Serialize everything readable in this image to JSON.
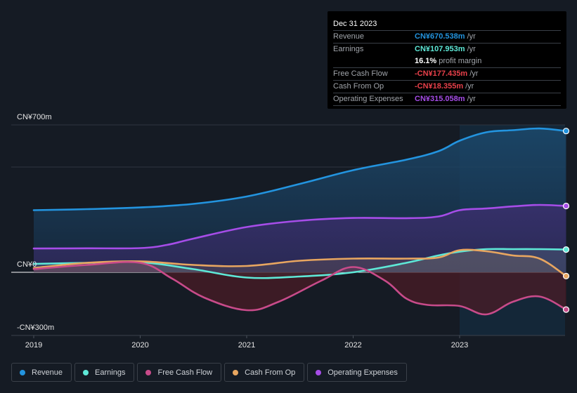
{
  "tooltip": {
    "date": "Dec 31 2023",
    "rows": [
      {
        "label": "Revenue",
        "value": "CN¥670.538m",
        "unit": "/yr",
        "color": "#2394df"
      },
      {
        "label": "Earnings",
        "value": "CN¥107.953m",
        "unit": "/yr",
        "color": "#5ee8d7"
      },
      {
        "label": "",
        "value": "16.1%",
        "unit": "profit margin",
        "color": "#ffffff"
      },
      {
        "label": "Free Cash Flow",
        "value": "-CN¥177.435m",
        "unit": "/yr",
        "color": "#e8404a"
      },
      {
        "label": "Cash From Op",
        "value": "-CN¥18.355m",
        "unit": "/yr",
        "color": "#e8404a"
      },
      {
        "label": "Operating Expenses",
        "value": "CN¥315.058m",
        "unit": "/yr",
        "color": "#a64de8"
      }
    ]
  },
  "legend": [
    {
      "label": "Revenue",
      "color": "#2394df"
    },
    {
      "label": "Earnings",
      "color": "#5ee8d7"
    },
    {
      "label": "Free Cash Flow",
      "color": "#c84b8a"
    },
    {
      "label": "Cash From Op",
      "color": "#e8a660"
    },
    {
      "label": "Operating Expenses",
      "color": "#a64de8"
    }
  ],
  "chart_data": {
    "type": "area",
    "title": "",
    "xlabel": "",
    "ylabel": "",
    "unit": "CN¥ millions",
    "ylim": [
      -300,
      700
    ],
    "xlim": [
      2018.8,
      2024.0
    ],
    "y_tick_labels": [
      {
        "value": 700,
        "label": "CN¥700m"
      },
      {
        "value": 0,
        "label": "CN¥0"
      },
      {
        "value": -300,
        "label": "-CN¥300m"
      }
    ],
    "gridlines": [
      700,
      500,
      0
    ],
    "x_tick_labels": [
      {
        "value": 2019,
        "label": "2019"
      },
      {
        "value": 2020,
        "label": "2020"
      },
      {
        "value": 2021,
        "label": "2021"
      },
      {
        "value": 2022,
        "label": "2022"
      },
      {
        "value": 2023,
        "label": "2023"
      }
    ],
    "highlight_start": 2023.0,
    "series": [
      {
        "name": "Revenue",
        "color": "#2394df",
        "x": [
          2019.0,
          2019.5,
          2020.0,
          2020.5,
          2021.0,
          2021.5,
          2022.0,
          2022.5,
          2022.8,
          2023.0,
          2023.25,
          2023.5,
          2023.75,
          2024.0
        ],
        "values": [
          295,
          300,
          308,
          325,
          360,
          420,
          485,
          535,
          575,
          625,
          665,
          675,
          683,
          671
        ]
      },
      {
        "name": "Operating Expenses",
        "color": "#a64de8",
        "x": [
          2019.0,
          2019.5,
          2020.0,
          2020.25,
          2020.5,
          2021.0,
          2021.5,
          2022.0,
          2022.5,
          2022.8,
          2023.0,
          2023.25,
          2023.5,
          2023.75,
          2024.0
        ],
        "values": [
          113,
          114,
          115,
          130,
          160,
          215,
          245,
          258,
          257,
          265,
          295,
          303,
          313,
          320,
          315
        ]
      },
      {
        "name": "Earnings",
        "color": "#5ee8d7",
        "x": [
          2019.0,
          2019.5,
          2020.0,
          2020.5,
          2021.0,
          2021.5,
          2022.0,
          2022.5,
          2022.8,
          2023.0,
          2023.25,
          2023.5,
          2023.75,
          2024.0
        ],
        "values": [
          40,
          45,
          48,
          15,
          -25,
          -20,
          0,
          45,
          80,
          98,
          110,
          110,
          110,
          108
        ]
      },
      {
        "name": "Cash From Op",
        "color": "#e8a660",
        "x": [
          2019.0,
          2019.5,
          2020.0,
          2020.5,
          2021.0,
          2021.5,
          2022.0,
          2022.5,
          2022.8,
          2023.0,
          2023.25,
          2023.5,
          2023.75,
          2024.0
        ],
        "values": [
          20,
          45,
          52,
          35,
          30,
          55,
          65,
          65,
          70,
          105,
          100,
          80,
          65,
          -18
        ]
      },
      {
        "name": "Free Cash Flow",
        "color": "#c84b8a",
        "x": [
          2019.0,
          2019.5,
          2020.0,
          2020.3,
          2020.6,
          2021.0,
          2021.3,
          2021.7,
          2022.0,
          2022.3,
          2022.5,
          2022.7,
          2023.0,
          2023.25,
          2023.5,
          2023.75,
          2024.0
        ],
        "values": [
          15,
          35,
          45,
          -30,
          -120,
          -180,
          -140,
          -40,
          25,
          -40,
          -125,
          -155,
          -160,
          -200,
          -140,
          -115,
          -177
        ]
      }
    ]
  }
}
